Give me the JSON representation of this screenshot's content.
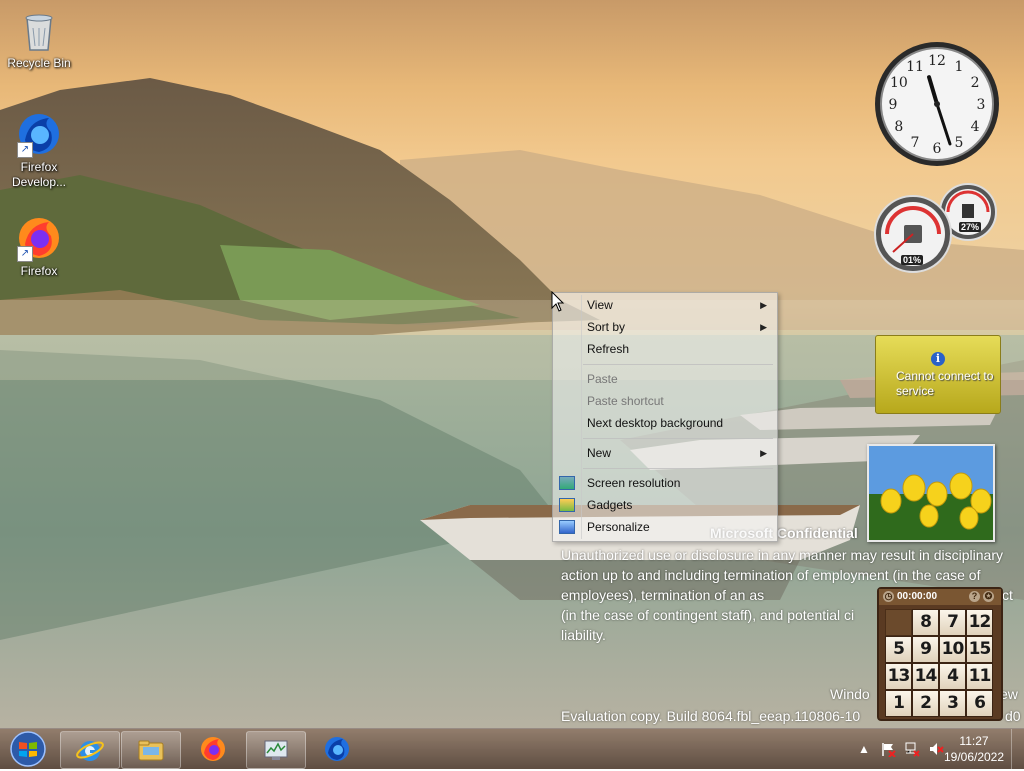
{
  "desktop": {
    "icons": [
      {
        "label": "Recycle Bin",
        "icon": "recycle-bin-icon"
      },
      {
        "label": "Firefox Develop...",
        "icon": "firefox-developer-icon"
      },
      {
        "label": "Firefox",
        "icon": "firefox-icon"
      }
    ]
  },
  "context_menu": {
    "items": [
      {
        "label": "View",
        "submenu": true,
        "enabled": true
      },
      {
        "label": "Sort by",
        "submenu": true,
        "enabled": true
      },
      {
        "label": "Refresh",
        "enabled": true
      },
      {
        "label": "Paste",
        "enabled": false
      },
      {
        "label": "Paste shortcut",
        "enabled": false
      },
      {
        "label": "Next desktop background",
        "enabled": true
      },
      {
        "label": "New",
        "submenu": true,
        "enabled": true
      },
      {
        "label": "Screen resolution",
        "icon": "screen-resolution-icon",
        "enabled": true
      },
      {
        "label": "Gadgets",
        "icon": "gadgets-icon",
        "enabled": true
      },
      {
        "label": "Personalize",
        "icon": "personalize-icon",
        "enabled": true
      }
    ]
  },
  "watermark": {
    "title": "Microsoft Confidential",
    "body": "Unauthorized use or disclosure in any manner may result in disciplinary action up to and including termination of employment (in the case of employees), termination of an as",
    "body_tail": "ct",
    "line4": "(in the case of contingent staff), and potential ci",
    "line5": "liability.",
    "windows": "Windo",
    "windows_tail": "ew",
    "build": "Evaluation copy. Build 8064.fbl_eeap.110806-10",
    "build_tail": "d0"
  },
  "gadgets": {
    "clock": {
      "hour": 11,
      "minute": 27,
      "numerals": [
        "12",
        "1",
        "2",
        "3",
        "4",
        "5",
        "6",
        "7",
        "8",
        "9",
        "10",
        "11"
      ]
    },
    "cpu_meter": {
      "cpu_percent": "01%",
      "memory_percent": "27%"
    },
    "weather": {
      "message": "Cannot connect to service",
      "icon": "info-icon"
    },
    "slideshow": {
      "subject": "yellow tulips"
    },
    "puzzle": {
      "timer": "00:00:00",
      "tiles": [
        "",
        "8",
        "7",
        "12",
        "5",
        "9",
        "10",
        "15",
        "13",
        "14",
        "4",
        "11",
        "1",
        "2",
        "3",
        "6"
      ]
    }
  },
  "taskbar": {
    "start_icon": "windows-start-orb-icon",
    "apps": [
      {
        "name": "Internet Explorer",
        "icon": "internet-explorer-icon",
        "pinned": true
      },
      {
        "name": "Windows Explorer",
        "icon": "folder-icon",
        "pinned": true
      },
      {
        "name": "Firefox",
        "icon": "firefox-icon",
        "pinned": false
      },
      {
        "name": "Resource Monitor",
        "icon": "resource-monitor-icon",
        "pinned": true
      },
      {
        "name": "Firefox Developer Edition",
        "icon": "firefox-developer-icon",
        "pinned": false
      }
    ],
    "tray": {
      "icons": [
        "show-hidden-icons-icon",
        "action-center-flag-icon",
        "network-icon",
        "volume-muted-icon"
      ],
      "time": "11:27",
      "date": "19/06/2022"
    }
  },
  "colors": {
    "taskbar": "#6e5a4a",
    "weather_gadget": "#d4c63a",
    "puzzle_frame": "#5a3a22"
  }
}
